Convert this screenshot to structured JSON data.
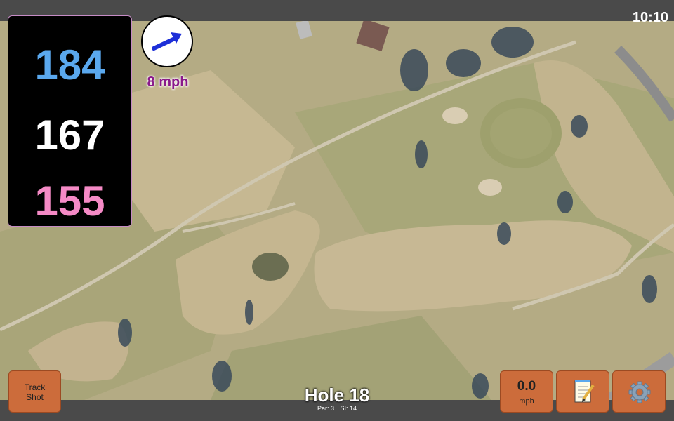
{
  "status_bar": {
    "time": "10:10"
  },
  "distances": {
    "back": "184",
    "middle": "167",
    "front": "155"
  },
  "wind": {
    "speed": "8 mph",
    "direction_icon": "wind-arrow-icon"
  },
  "hole": {
    "title": "Hole 18",
    "par": "Par: 3",
    "stroke_index": "SI: 14"
  },
  "buttons": {
    "track_shot": {
      "line1": "Track",
      "line2": "Shot"
    },
    "speed": {
      "value": "0.0",
      "unit": "mph"
    },
    "notes_icon": "notepad-icon",
    "settings_icon": "gear-icon"
  },
  "colors": {
    "back": "#5aa8ee",
    "middle": "#ffffff",
    "front": "#f58ac6",
    "wind_text": "#8a1a8a",
    "button": "#cc6c3b"
  }
}
